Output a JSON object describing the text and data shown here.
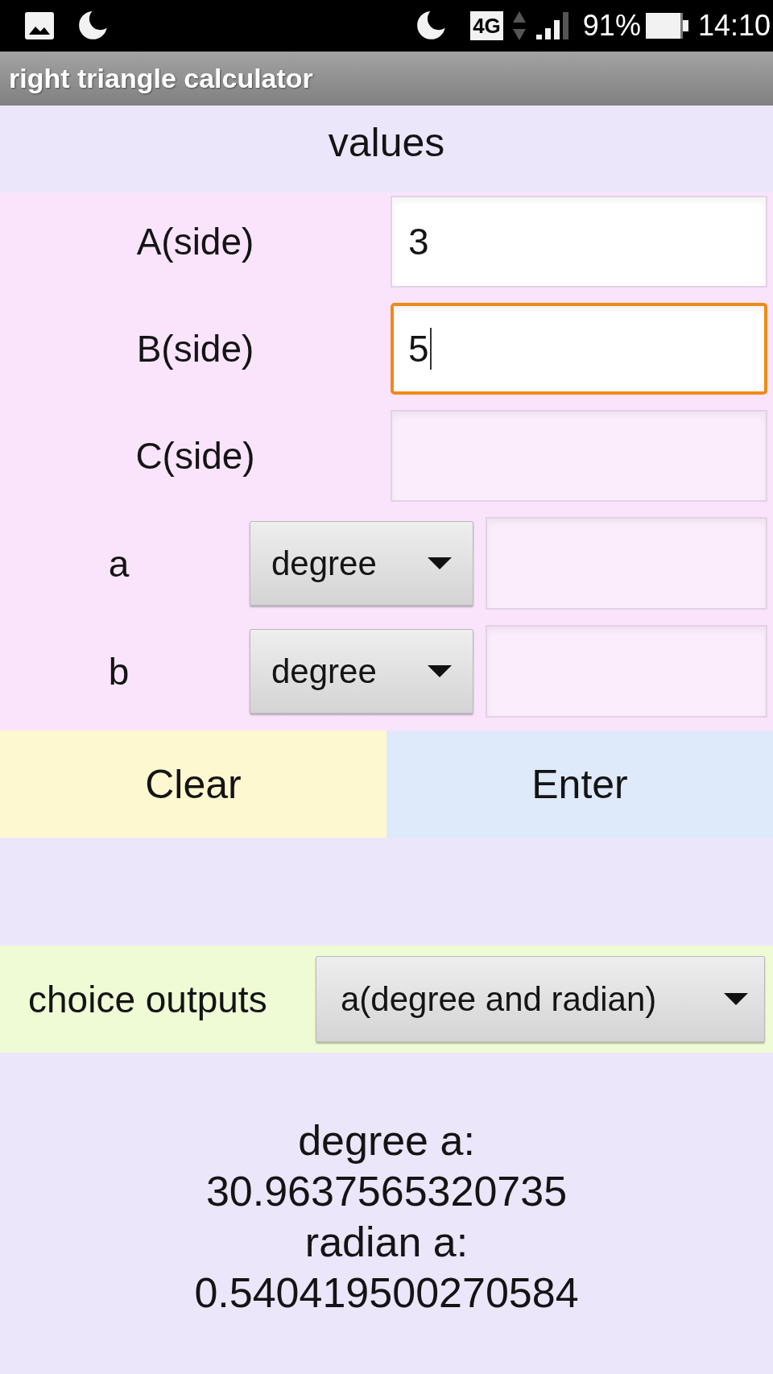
{
  "status_bar": {
    "network": "4G",
    "battery": "91%",
    "time": "14:10"
  },
  "app_bar": {
    "title": "right triangle calculator"
  },
  "section": {
    "title": "values"
  },
  "sides": [
    {
      "label": "A(side)",
      "value": "3",
      "focused": false
    },
    {
      "label": "B(side)",
      "value": "5",
      "focused": true
    },
    {
      "label": "C(side)",
      "focused": false
    }
  ],
  "angles": [
    {
      "label": "a",
      "unit": "degree"
    },
    {
      "label": "b",
      "unit": "degree"
    }
  ],
  "buttons": [
    {
      "kind": "clear",
      "label": "Clear"
    },
    {
      "kind": "enter",
      "label": "Enter"
    }
  ],
  "output_choice": {
    "label": "choice outputs",
    "value": "a(degree and radian)"
  },
  "results": [
    "degree a:",
    "30.9637565320735",
    "radian a:",
    "0.540419500270584"
  ]
}
